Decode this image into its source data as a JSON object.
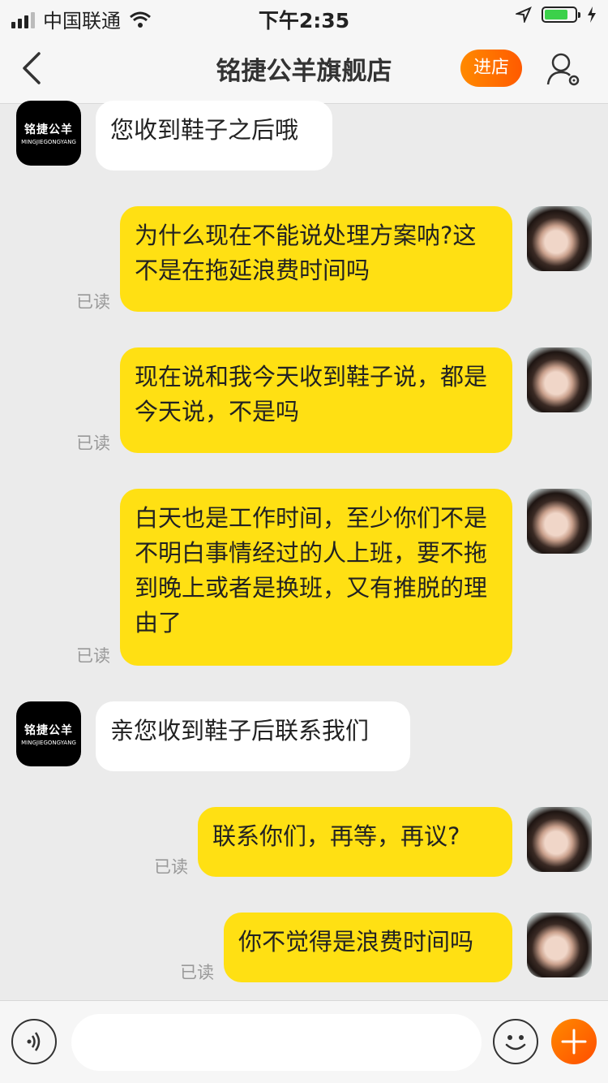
{
  "status_bar": {
    "carrier": "中国联通",
    "time": "下午2:35"
  },
  "nav": {
    "title": "铭捷公羊旗舰店",
    "store_button": "进店"
  },
  "shop_avatar": {
    "logo_cn": "铭捷公羊",
    "logo_en": "MINGJIEGONGYANG"
  },
  "messages": [
    {
      "side": "left",
      "text": "您收到鞋子之后哦"
    },
    {
      "side": "right",
      "text": "为什么现在不能说处理方案呐?这不是在拖延浪费时间吗",
      "status": "已读"
    },
    {
      "side": "right",
      "text": "现在说和我今天收到鞋子说，都是今天说，不是吗",
      "status": "已读"
    },
    {
      "side": "right",
      "text": "白天也是工作时间，至少你们不是不明白事情经过的人上班，要不拖到晚上或者是换班，又有推脱的理由了",
      "status": "已读"
    },
    {
      "side": "left",
      "text": "亲您收到鞋子后联系我们"
    },
    {
      "side": "right",
      "text": "联系你们，再等，再议?",
      "status": "已读"
    },
    {
      "side": "right",
      "text": "你不觉得是浪费时间吗",
      "status": "已读"
    }
  ],
  "input": {
    "placeholder": ""
  },
  "colors": {
    "bubble_right": "#ffe013",
    "bubble_left": "#ffffff",
    "accent": "#ff6a00",
    "background": "#ebebeb"
  },
  "icons": [
    "signal-icon",
    "wifi-icon",
    "location-icon",
    "battery-icon",
    "charging-icon",
    "back-chevron-icon",
    "user-settings-icon",
    "voice-icon",
    "emoji-icon",
    "plus-icon"
  ]
}
